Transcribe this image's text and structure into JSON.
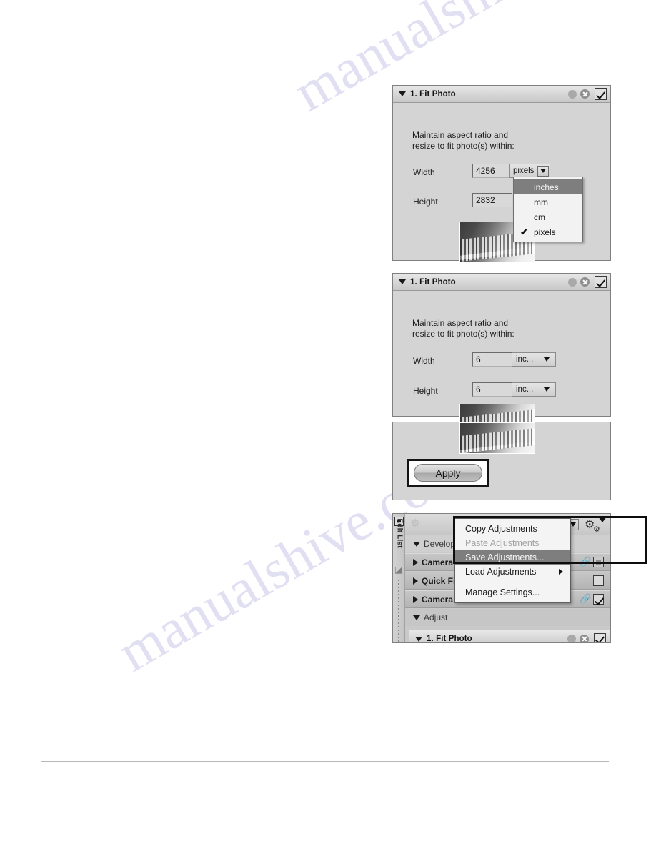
{
  "watermark": {
    "line1": "manualshive.com",
    "line2": "manualshive.com"
  },
  "panel_fit_photo_pixels": {
    "title": "1. Fit Photo",
    "hint": "Maintain aspect ratio and\nresize to fit photo(s) within:",
    "width_label": "Width",
    "width_value": "4256",
    "height_label": "Height",
    "height_value": "2832",
    "unit_selected": "pixels",
    "dropdown_options": [
      {
        "label": "inches",
        "checked": false,
        "highlighted": true
      },
      {
        "label": "mm",
        "checked": false,
        "highlighted": false
      },
      {
        "label": "cm",
        "checked": false,
        "highlighted": false
      },
      {
        "label": "pixels",
        "checked": true,
        "highlighted": false
      }
    ],
    "check_mark": "✔",
    "icons": {
      "help": "help-circle-icon",
      "reset": "reset-x-icon",
      "enable": "enable-checkbox"
    }
  },
  "panel_fit_photo_inches": {
    "title": "1. Fit Photo",
    "hint": "Maintain aspect ratio and\nresize to fit photo(s) within:",
    "width_label": "Width",
    "width_value": "6",
    "height_label": "Height",
    "height_value": "6",
    "unit_selected": "inc...",
    "check_mark": "✔"
  },
  "panel_apply": {
    "apply_label": "Apply"
  },
  "panel_edit_list": {
    "rail_label": "Edit List",
    "develop_label": "Develop",
    "sections": [
      {
        "label": "Camera S",
        "full_label": "Camera Settings",
        "expanded": false,
        "checkbox": "partial"
      },
      {
        "label": "Quick Fix",
        "full_label": "Quick Fix",
        "expanded": false,
        "checkbox": "empty"
      },
      {
        "label": "Camera & Lens Corrections",
        "full_label": "Camera & Lens Corrections",
        "expanded": false,
        "checkbox": "checked"
      },
      {
        "label": "Adjust",
        "full_label": "Adjust",
        "expanded": true,
        "checkbox": "none"
      },
      {
        "label": "1. Fit Photo",
        "full_label": "1. Fit Photo",
        "expanded": true,
        "checkbox": "checked"
      }
    ],
    "context_menu": [
      {
        "label": "Copy Adjustments",
        "state": "normal",
        "submenu": false
      },
      {
        "label": "Paste Adjustments",
        "state": "disabled",
        "submenu": false
      },
      {
        "label": "Save Adjustments...",
        "state": "selected",
        "submenu": false
      },
      {
        "label": "Load Adjustments",
        "state": "normal",
        "submenu": true
      },
      {
        "separator": true
      },
      {
        "label": "Manage Settings...",
        "state": "normal",
        "submenu": false
      }
    ],
    "icons": {
      "collapse": "collapse-icon",
      "sunburst": "sunburst-icon",
      "gear": "gear-icon",
      "link": "link-chain-icon"
    }
  },
  "colors": {
    "panel_bg": "#d4d4d4",
    "panel_border": "#808080",
    "header_grad_top": "#e8e8e8",
    "selection": "#7e7e7e",
    "watermark": "#c9c6e8",
    "focus_ring": "#0e0e0e"
  }
}
